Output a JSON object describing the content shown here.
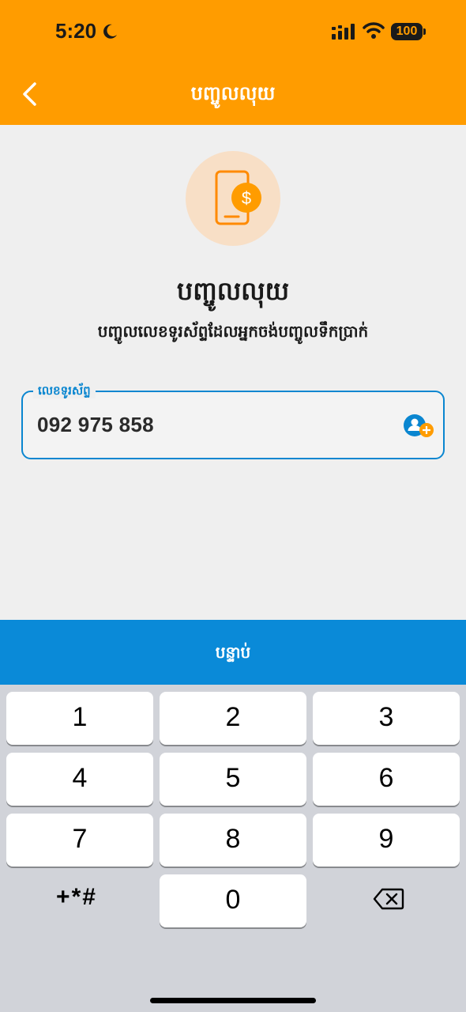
{
  "status_bar": {
    "time": "5:20",
    "battery": "100",
    "icons": [
      "moon-icon",
      "signal-icon",
      "wifi-icon",
      "battery-icon"
    ]
  },
  "nav": {
    "title": "បញ្ចូលលុយ",
    "back_icon": "chevron-left-icon"
  },
  "hero": {
    "icon": "phone-dollar-icon",
    "title": "បញ្ចូលលុយ",
    "subtitle": "បញ្ចូលលេខទូរស័ព្ទដែលអ្នកចង់បញ្ចូលទឹកប្រាក់"
  },
  "phone_field": {
    "label": "លេខទូរស័ព្ទ",
    "value": "092 975 858",
    "icon": "add-contact-icon"
  },
  "next_button": {
    "label": "បន្ទាប់"
  },
  "keypad": {
    "keys": [
      "1",
      "2",
      "3",
      "4",
      "5",
      "6",
      "7",
      "8",
      "9",
      "+*#",
      "0"
    ],
    "backspace_icon": "backspace-icon"
  },
  "colors": {
    "header": "#ff9c00",
    "accent_blue": "#0a8ad8",
    "background": "#efefef",
    "keyboard": "#d1d3d9"
  }
}
